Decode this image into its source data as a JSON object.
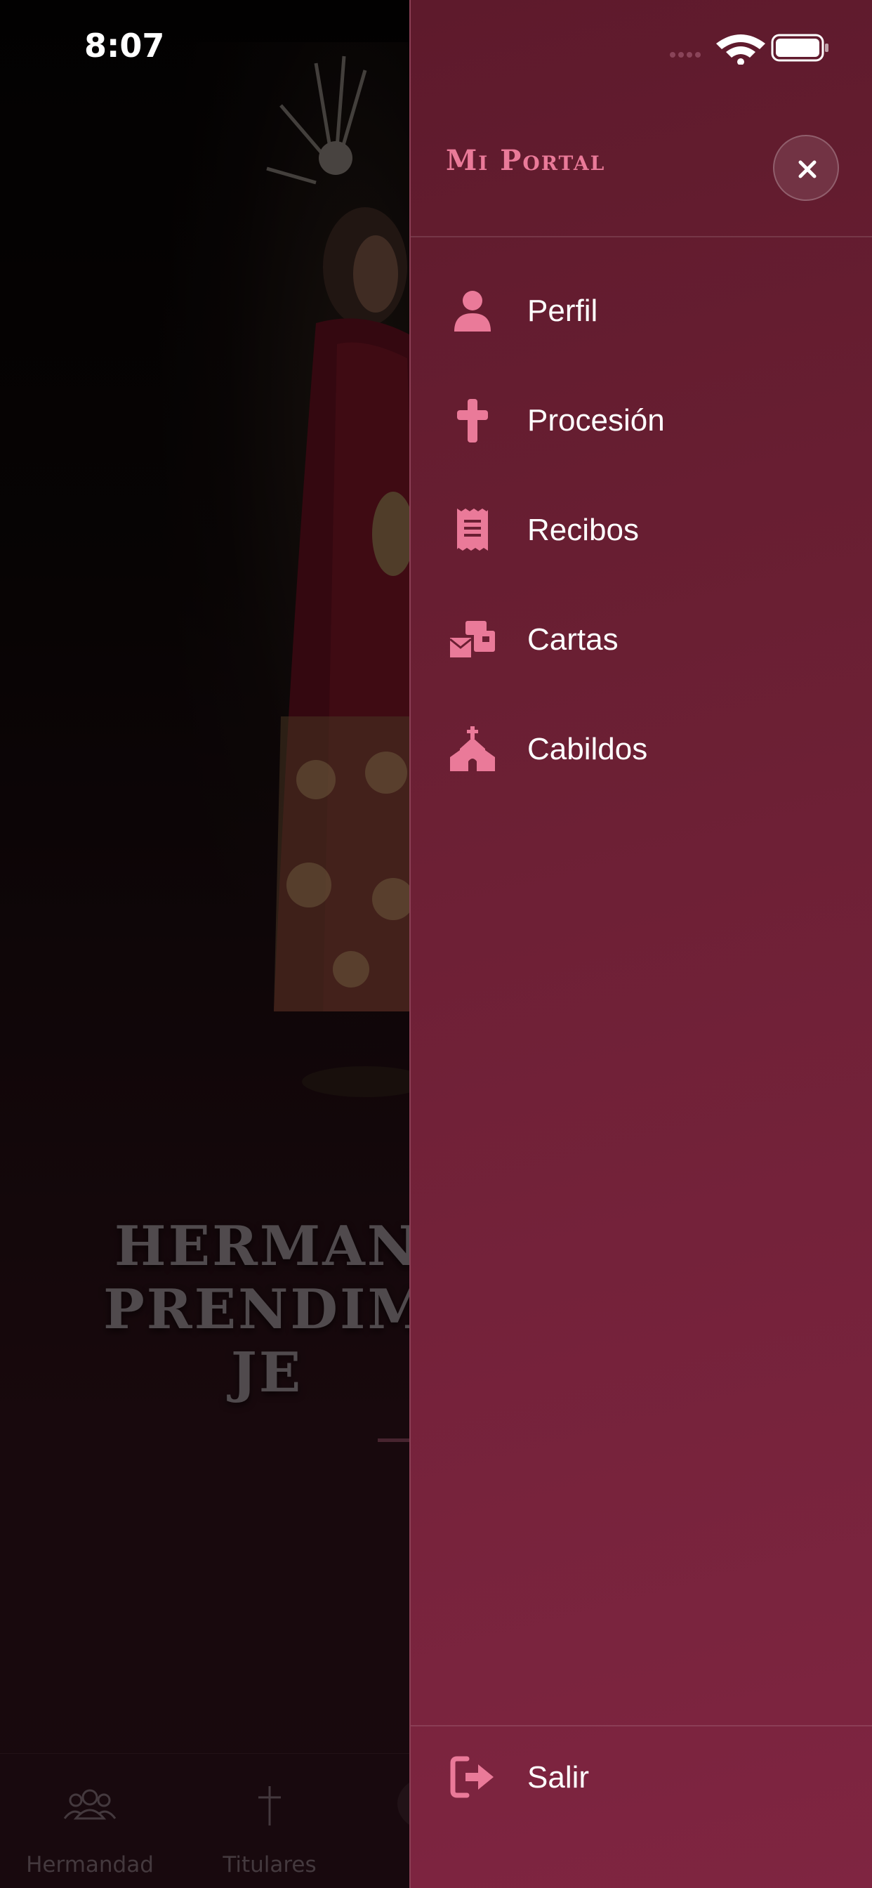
{
  "status_bar": {
    "time": "8:07"
  },
  "background": {
    "hero_title": [
      "HERMAN",
      "PRENDIM",
      "JE"
    ],
    "tabs": [
      {
        "label": "Hermandad",
        "icon": "people-icon"
      },
      {
        "label": "Titulares",
        "icon": "cross-icon"
      }
    ]
  },
  "drawer": {
    "title": "Mi Portal",
    "close_icon": "close-icon",
    "items": [
      {
        "label": "Perfil",
        "icon": "user-icon"
      },
      {
        "label": "Procesión",
        "icon": "cross-icon"
      },
      {
        "label": "Recibos",
        "icon": "receipt-icon"
      },
      {
        "label": "Cartas",
        "icon": "mail-bulk-icon"
      },
      {
        "label": "Cabildos",
        "icon": "church-icon"
      }
    ],
    "logout": {
      "label": "Salir",
      "icon": "sign-out-icon"
    }
  },
  "colors": {
    "accent": "#ea7a99",
    "drawer_bg": "#6a1f33",
    "tab_label": "#76636b"
  }
}
